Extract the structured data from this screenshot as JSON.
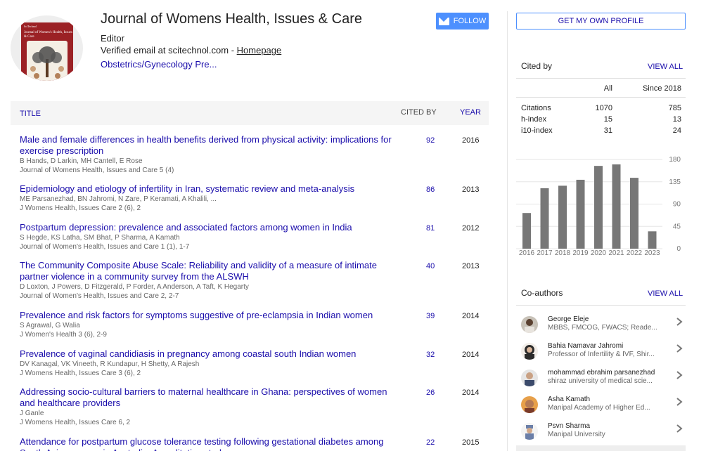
{
  "profile": {
    "name": "Journal of Womens Health, Issues & Care",
    "affiliation": "Editor",
    "email_text": "Verified email at scitechnol.com - ",
    "homepage_label": "Homepage",
    "interest": "Obstetrics/Gynecology Pre...",
    "cover_small": "SciTechnol",
    "cover_title": "Journal of Women's Health, Issues & Care",
    "follow_label": "FOLLOW",
    "own_profile_label": "GET MY OWN PROFILE"
  },
  "table": {
    "col_title": "TITLE",
    "col_cited": "CITED BY",
    "col_year": "YEAR",
    "rows": [
      {
        "title": "Male and female differences in health benefits derived from physical activity: implications for exercise prescription",
        "authors": "B Hands, D Larkin, MH Cantell, E Rose",
        "venue": "Journal of Womens Health, Issues and Care 5 (4)",
        "cites": "92",
        "year": "2016"
      },
      {
        "title": "Epidemiology and etiology of infertility in Iran, systematic review and meta-analysis",
        "authors": "ME Parsanezhad, BN Jahromi, N Zare, P Keramati, A Khalili, ...",
        "venue": "J Womens Health, Issues Care 2 (6), 2",
        "cites": "86",
        "year": "2013"
      },
      {
        "title": "Postpartum depression: prevalence and associated factors among women in India",
        "authors": "S Hegde, KS Latha, SM Bhat, P Sharma, A Kamath",
        "venue": "Journal of Women's Health, Issues and Care 1 (1), 1-7",
        "cites": "81",
        "year": "2012"
      },
      {
        "title": "The Community Composite Abuse Scale: Reliability and validity of a measure of intimate partner violence in a community survey from the ALSWH",
        "authors": "D Loxton, J Powers, D Fitzgerald, P Forder, A Anderson, A Taft, K Hegarty",
        "venue": "Journal of Women's Health, Issues and Care 2, 2-7",
        "cites": "40",
        "year": "2013"
      },
      {
        "title": "Prevalence and risk factors for symptoms suggestive of pre-eclampsia in Indian women",
        "authors": "S Agrawal, G Walia",
        "venue": "J Women's Health 3 (6), 2-9",
        "cites": "39",
        "year": "2014"
      },
      {
        "title": "Prevalence of vaginal candidiasis in pregnancy among coastal south Indian women",
        "authors": "DV Kanagal, VK Vineeth, R Kundapur, H Shetty, A Rajesh",
        "venue": "J Womens Health, Issues Care 3 (6), 2",
        "cites": "32",
        "year": "2014"
      },
      {
        "title": "Addressing socio-cultural barriers to maternal healthcare in Ghana: perspectives of women and healthcare providers",
        "authors": "J Ganle",
        "venue": "J Womens Health, Issues Care 6, 2",
        "cites": "26",
        "year": "2014"
      },
      {
        "title": "Attendance for postpartum glucose tolerance testing following gestational diabetes among South Asian women in Australia: A qualitative study",
        "authors": "",
        "venue": "",
        "cites": "22",
        "year": "2015"
      }
    ]
  },
  "cited_by": {
    "title": "Cited by",
    "view_all": "VIEW ALL",
    "col_all": "All",
    "col_since": "Since 2018",
    "stats": [
      {
        "label": "Citations",
        "all": "1070",
        "since": "785"
      },
      {
        "label": "h-index",
        "all": "15",
        "since": "13"
      },
      {
        "label": "i10-index",
        "all": "31",
        "since": "24"
      }
    ]
  },
  "chart_data": {
    "type": "bar",
    "categories": [
      "2016",
      "2017",
      "2018",
      "2019",
      "2020",
      "2021",
      "2022",
      "2023"
    ],
    "values": [
      72,
      122,
      127,
      139,
      167,
      170,
      143,
      35
    ],
    "ylim": [
      0,
      180
    ],
    "yticks": [
      "180",
      "135",
      "90",
      "45",
      "0"
    ],
    "grid": true,
    "bar_color": "#777777"
  },
  "coauthors": {
    "title": "Co-authors",
    "view_all": "VIEW ALL",
    "items": [
      {
        "name": "George Eleje",
        "affil": "MBBS, FMCOG, FWACS; Reade...",
        "icon": "avatar-photo"
      },
      {
        "name": "Bahia Namavar Jahromi",
        "affil": "Professor of Infertility & IVF, Shir...",
        "icon": "avatar-photo"
      },
      {
        "name": "mohammad ebrahim parsanezhad",
        "affil": "shiraz university of medical scie...",
        "icon": "avatar-photo"
      },
      {
        "name": "Asha Kamath",
        "affil": "Manipal Academy of Higher Ed...",
        "icon": "avatar-photo"
      },
      {
        "name": "Psvn Sharma",
        "affil": "Manipal University",
        "icon": "avatar-photo"
      }
    ]
  }
}
